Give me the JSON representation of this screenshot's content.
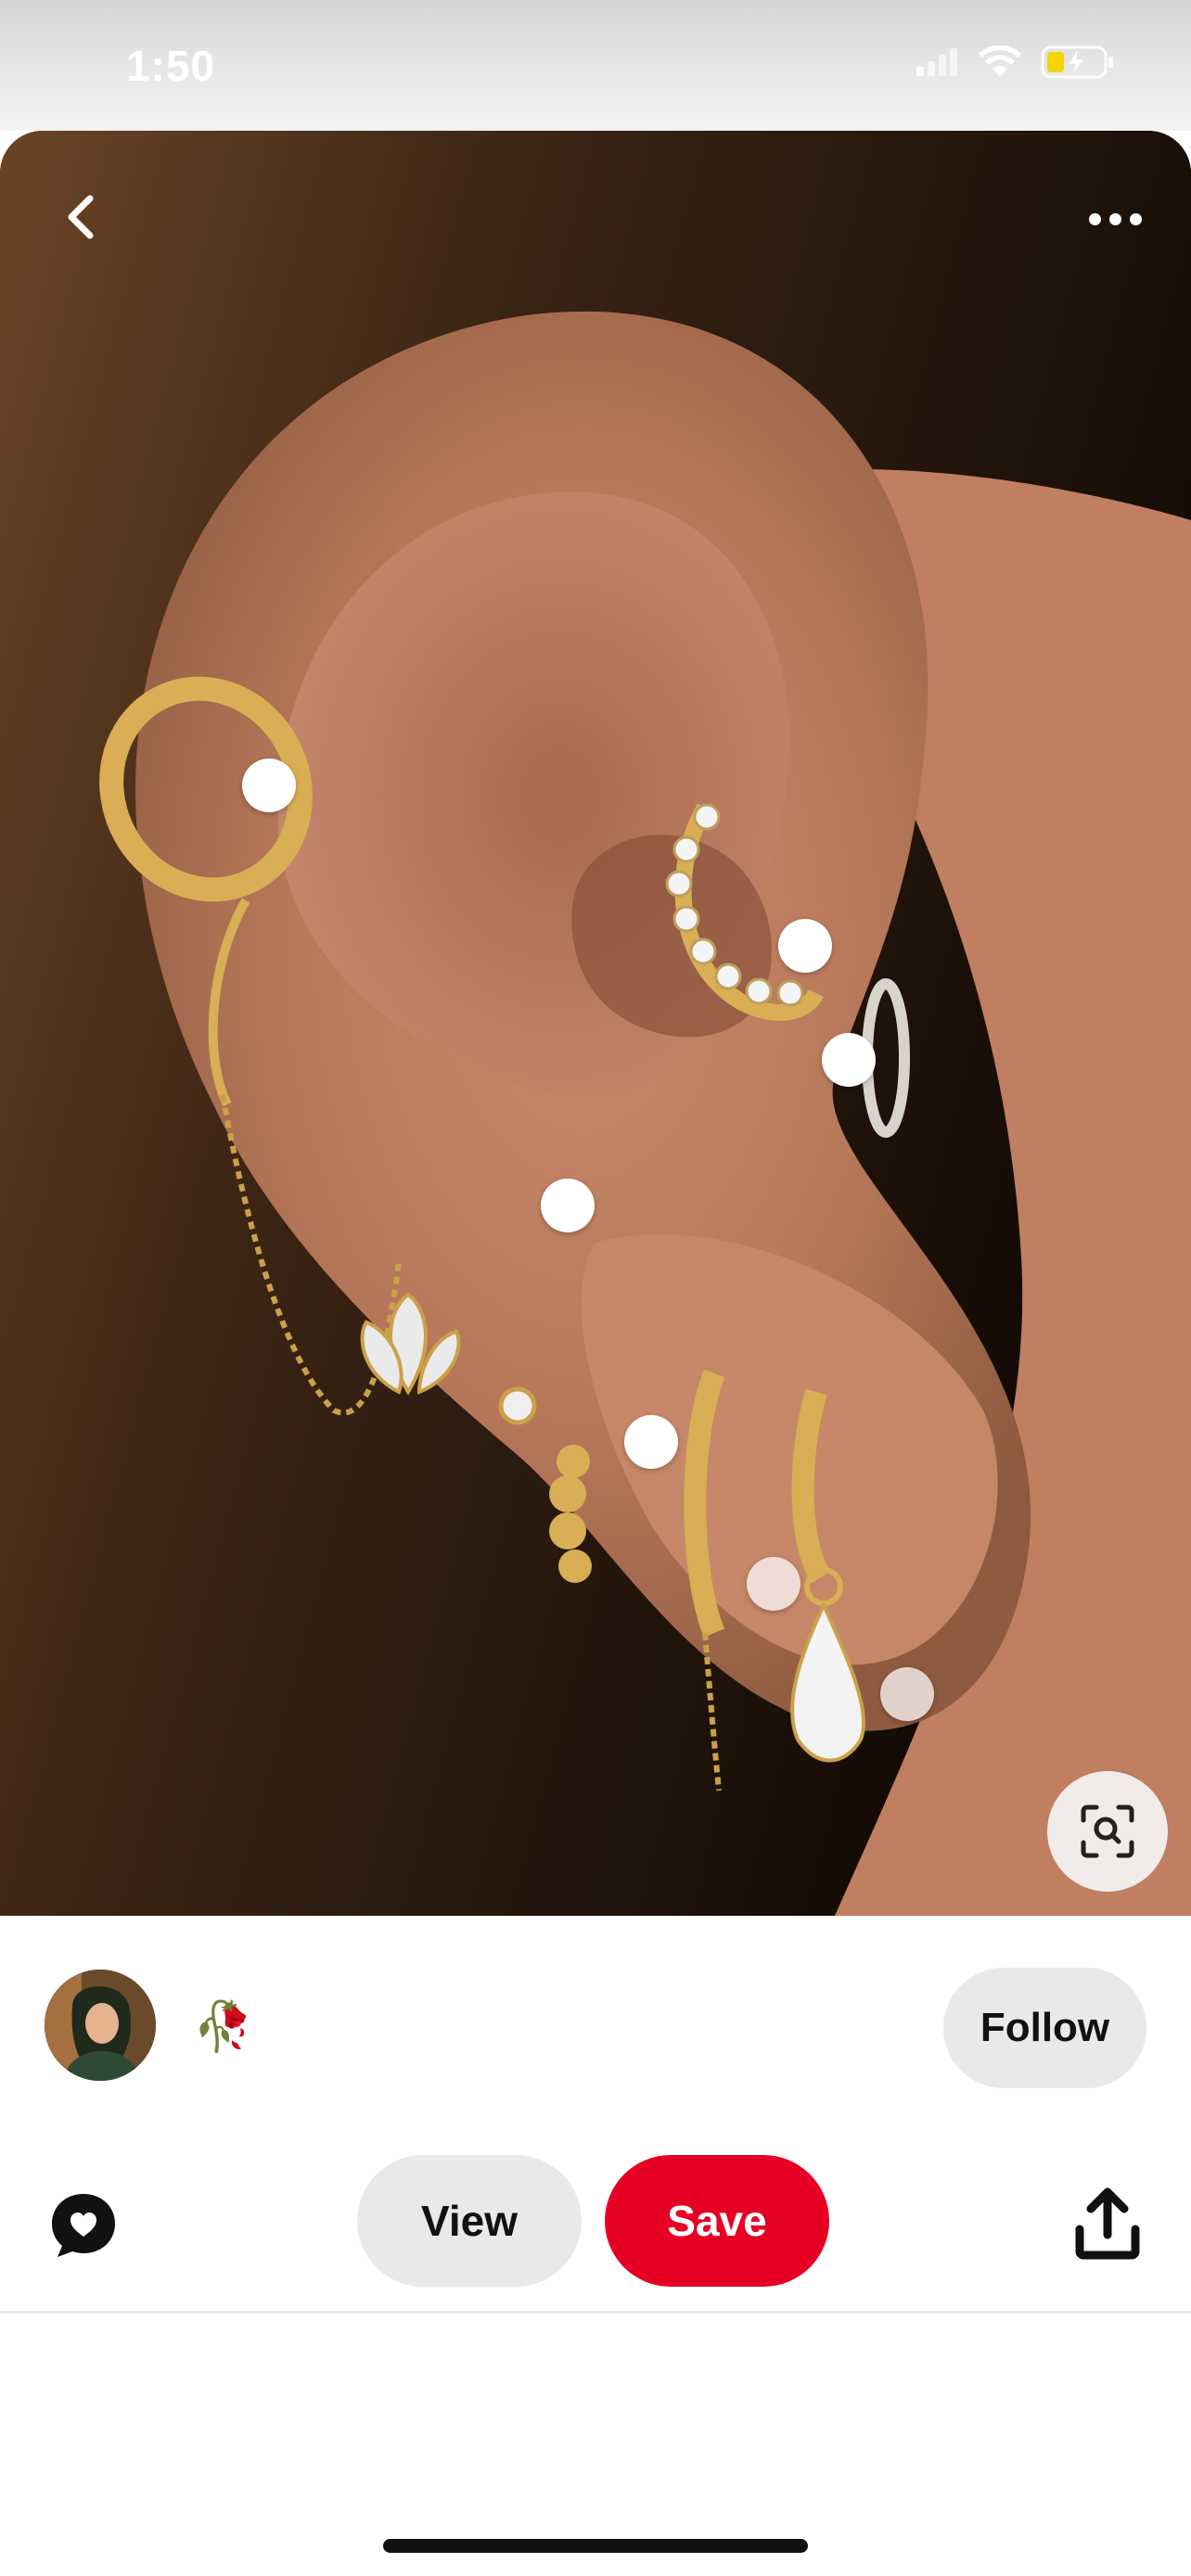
{
  "status_bar": {
    "time": "1:50",
    "icons": [
      "signal-icon",
      "wifi-icon",
      "battery-charging-icon"
    ],
    "battery_color": "#f5d400"
  },
  "pin": {
    "image_icons": [
      "back-arrow-icon",
      "more-options-icon",
      "visual-search-icon"
    ]
  },
  "creator": {
    "emoji": "🥀",
    "follow_label": "Follow"
  },
  "actions": {
    "view_label": "View",
    "save_label": "Save",
    "icons": [
      "comment-heart-icon",
      "share-icon"
    ]
  },
  "colors": {
    "save_red": "#e60023",
    "pill_gray": "#e9e9e9",
    "text_dark": "#111111"
  }
}
